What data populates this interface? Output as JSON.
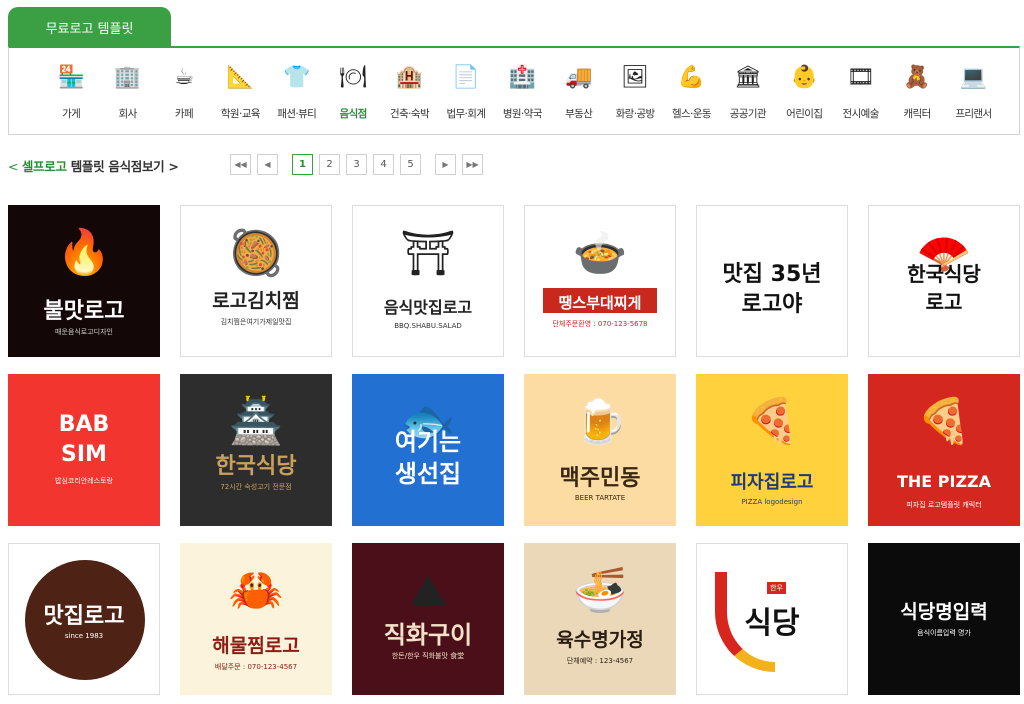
{
  "tab_label": "무료로고 템플릿",
  "categories": [
    {
      "label": "가게",
      "icon": "store-icon"
    },
    {
      "label": "회사",
      "icon": "building-icon"
    },
    {
      "label": "카페",
      "icon": "coffee-icon"
    },
    {
      "label": "학원·교육",
      "icon": "education-icon"
    },
    {
      "label": "패션·뷰티",
      "icon": "tshirt-icon"
    },
    {
      "label": "음식점",
      "icon": "dish-icon"
    },
    {
      "label": "건축·숙박",
      "icon": "hotel-icon"
    },
    {
      "label": "법무·회계",
      "icon": "document-icon"
    },
    {
      "label": "병원·약국",
      "icon": "hospital-icon"
    },
    {
      "label": "부동산",
      "icon": "truck-icon"
    },
    {
      "label": "화랑·공방",
      "icon": "art-icon"
    },
    {
      "label": "헬스·운동",
      "icon": "muscle-icon"
    },
    {
      "label": "공공기관",
      "icon": "emblem-icon"
    },
    {
      "label": "어린이집",
      "icon": "baby-icon"
    },
    {
      "label": "전시예술",
      "icon": "gallery-icon"
    },
    {
      "label": "캐릭터",
      "icon": "teddy-bear-icon"
    },
    {
      "label": "프리랜서",
      "icon": "laptop-icon"
    }
  ],
  "breadcrumb": {
    "prefix": "< ",
    "brand": "셀프로고",
    "rest": " 템플릿 음식점보기 >"
  },
  "pagination": {
    "first": "◀◀",
    "prev": "◀",
    "pages": [
      "1",
      "2",
      "3",
      "4",
      "5"
    ],
    "current": "1",
    "next": "▶",
    "last": "▶▶"
  },
  "logos": [
    {
      "title": "불맛로고",
      "sub": "매운음식로고디자인",
      "bg": "#130707",
      "fg": "#ffffff",
      "subfg": "#cfcfcf",
      "art": "🔥",
      "titleSize": 22,
      "titleTop": 88
    },
    {
      "title": "로고김치찜",
      "sub": "김치찜은여기가제일맛집",
      "bg": "#ffffff",
      "fg": "#222222",
      "subfg": "#333333",
      "art": "🥘",
      "titleSize": 19,
      "titleTop": 80
    },
    {
      "title": "음식맛집로고",
      "sub": "BBQ.SHABU.SALAD",
      "bg": "#ffffff",
      "fg": "#222222",
      "subfg": "#333333",
      "art": "⛩",
      "titleSize": 16,
      "titleTop": 88
    },
    {
      "title": "땡스부대찌게",
      "sub": "단체주문환영 : 070-123-5678",
      "bg": "#ffffff",
      "fg": "#ffffff",
      "subfg": "#c8281e",
      "art": "🍲",
      "titleSize": 15,
      "titleTop": 86,
      "band": "#c8281e"
    },
    {
      "title": "맛집 35년",
      "title2": "로고야",
      "sub": "",
      "bg": "#ffffff",
      "fg": "#111111",
      "subfg": "#333333",
      "art": "",
      "titleSize": 22,
      "titleTop": 50
    },
    {
      "title": "한국식당",
      "title2": "로고",
      "sub": "",
      "bg": "#ffffff",
      "fg": "#111111",
      "subfg": "#333333",
      "art": "🪭",
      "titleSize": 20,
      "titleTop": 52
    },
    {
      "title": "BAB",
      "title2": "SIM",
      "sub": "밥심코리안레스토랑",
      "bg": "#f2352e",
      "fg": "#ffffff",
      "subfg": "#ffffff",
      "art": "",
      "titleSize": 22,
      "titleTop": 38
    },
    {
      "title": "한국식당",
      "sub": "72시간 숙성고기 전문점",
      "bg": "#2d2d2d",
      "fg": "#caa15c",
      "subfg": "#caa15c",
      "art": "🏯",
      "titleSize": 22,
      "titleTop": 74
    },
    {
      "title": "여기는",
      "title2": "생선집",
      "sub": "",
      "bg": "#2170d2",
      "fg": "#ffffff",
      "subfg": "#ffffff",
      "art": "🐟",
      "titleSize": 24,
      "titleTop": 48
    },
    {
      "title": "맥주민동",
      "sub": "BEER TARTATE",
      "bg": "#fcdca2",
      "fg": "#3a2614",
      "subfg": "#3a2614",
      "art": "🍺",
      "titleSize": 22,
      "titleTop": 86
    },
    {
      "title": "피자집로고",
      "sub": "PIZZA logodesign",
      "bg": "#ffd23d",
      "fg": "#1d3b7c",
      "subfg": "#1d3b7c",
      "art": "🍕",
      "titleSize": 18,
      "titleTop": 94
    },
    {
      "title": "THE PIZZA",
      "sub": "피자집 로고템플릿 캐릭터",
      "bg": "#d4271f",
      "fg": "#ffffff",
      "subfg": "#ffffff",
      "art": "🍕",
      "titleSize": 16,
      "titleTop": 98
    },
    {
      "title": "맛집로고",
      "sub": "since 1983",
      "bg": "#ffffff",
      "fg": "#ffffff",
      "subfg": "#ffffff",
      "art": "",
      "titleSize": 22,
      "titleTop": 54,
      "circle": "#4e2316"
    },
    {
      "title": "해물찜로고",
      "sub": "배달주문 : 070-123-4567",
      "bg": "#fbf3dc",
      "fg": "#8a1c12",
      "subfg": "#8a1c12",
      "art": "🦀",
      "titleSize": 19,
      "titleTop": 88
    },
    {
      "title": "직화구이",
      "sub": "한돈/한우 직화불맛 食堂",
      "bg": "#4a0f18",
      "fg": "#f4e3c8",
      "subfg": "#f4e3c8",
      "art": "⛰",
      "titleSize": 24,
      "titleTop": 72
    },
    {
      "title": "육수명가정",
      "sub": "단체예약 : 123-4567",
      "bg": "#ead8b8",
      "fg": "#2b1d12",
      "subfg": "#2b1d12",
      "art": "🍜",
      "titleSize": 19,
      "titleTop": 82
    },
    {
      "title": "식당",
      "sub": "한우",
      "bg": "#ffffff",
      "fg": "#111111",
      "subfg": "#ffffff",
      "art": "",
      "titleSize": 30,
      "titleTop": 54,
      "swoosh": true
    },
    {
      "title": "식당명입력",
      "sub": "음식이름입력 명가",
      "bg": "#0b0b0b",
      "fg": "#ffffff",
      "subfg": "#ffffff",
      "art": "",
      "titleSize": 19,
      "titleTop": 54
    }
  ]
}
